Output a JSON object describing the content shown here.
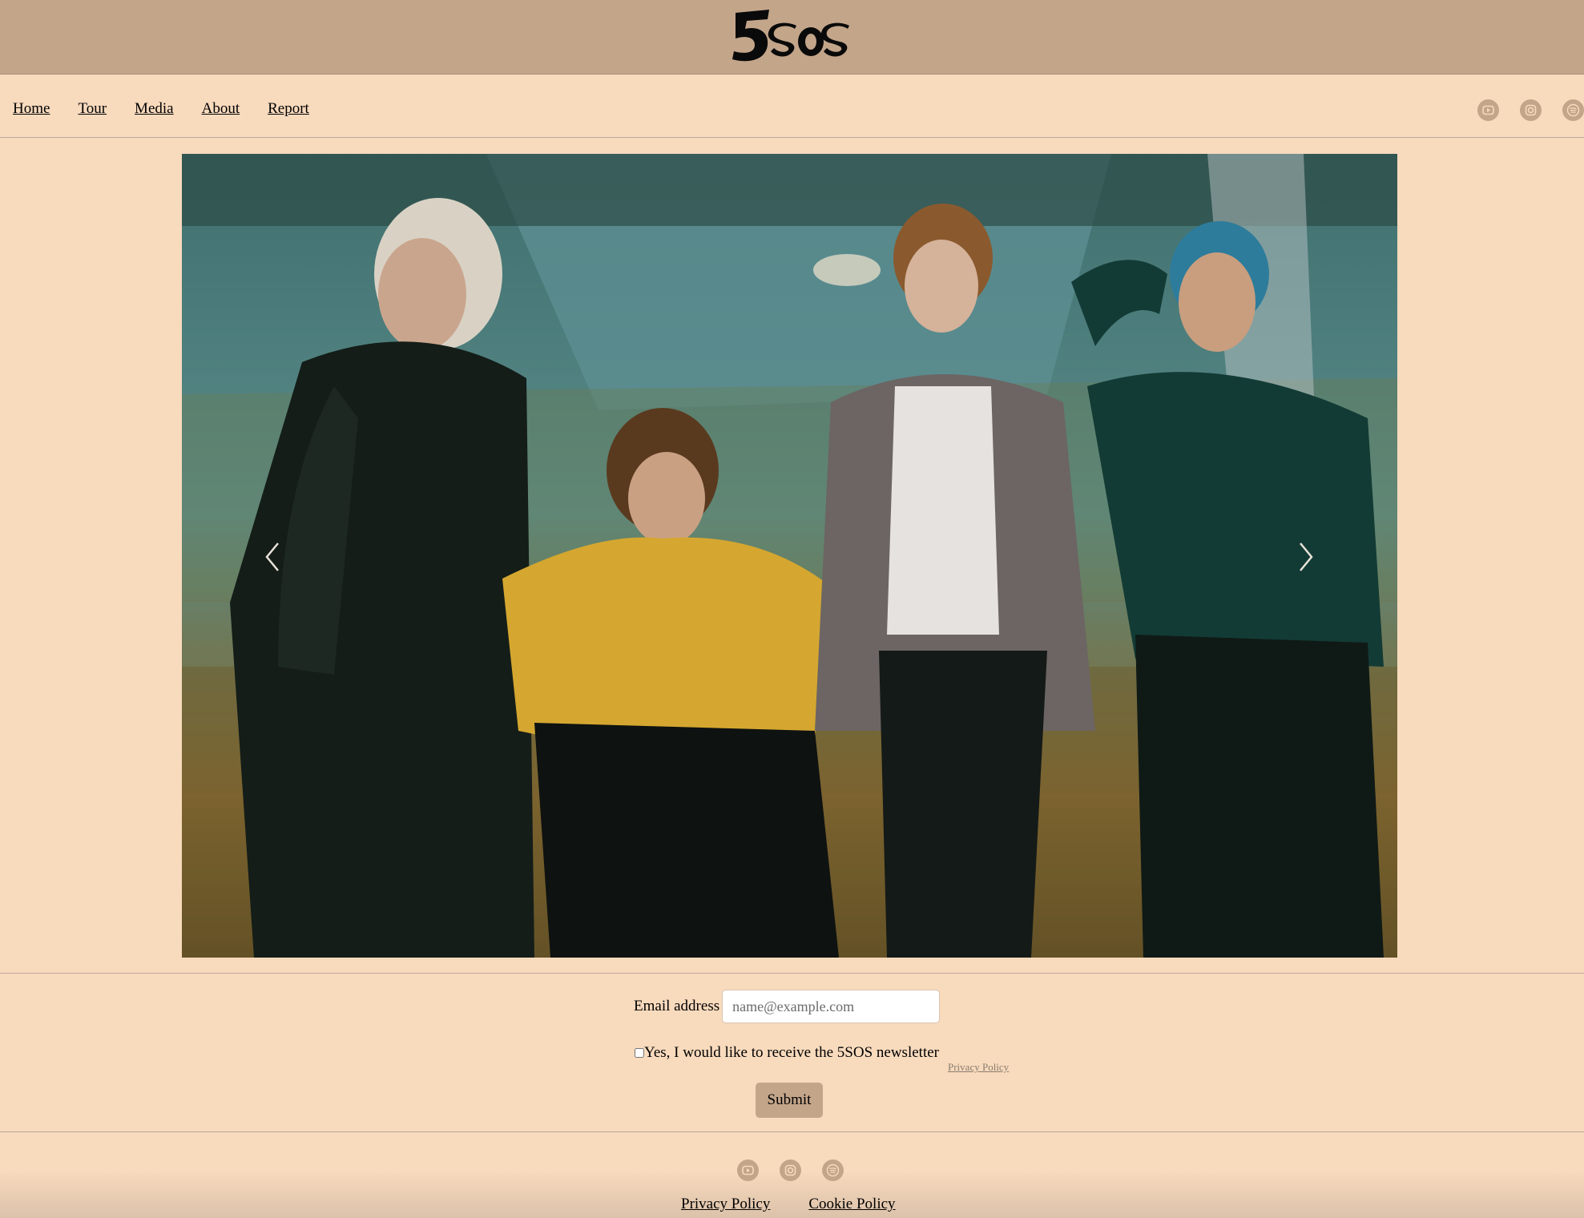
{
  "brand": {
    "logo_text": "5SOS"
  },
  "nav": {
    "items": [
      {
        "label": "Home"
      },
      {
        "label": "Tour"
      },
      {
        "label": "Media"
      },
      {
        "label": "About"
      },
      {
        "label": "Report"
      }
    ],
    "social_icons": [
      "youtube-icon",
      "instagram-icon",
      "spotify-icon"
    ]
  },
  "hero": {
    "carousel_prev_icon": "chevron-left-icon",
    "carousel_next_icon": "chevron-right-icon"
  },
  "newsletter": {
    "email_label": "Email address",
    "email_placeholder": "name@example.com",
    "email_value": "",
    "consent_label": "Yes, I would like to receive the 5SOS newsletter",
    "consent_checked": false,
    "privacy_link": "Privacy Policy",
    "submit_label": "Submit"
  },
  "footer": {
    "social_icons": [
      "youtube-icon",
      "instagram-icon",
      "spotify-icon"
    ],
    "links": [
      {
        "label": "Privacy Policy"
      },
      {
        "label": "Cookie Policy"
      }
    ]
  },
  "colors": {
    "page_bg": "#f8dabd",
    "header_bg": "#c3a58a",
    "button_bg": "#c3a58a"
  }
}
